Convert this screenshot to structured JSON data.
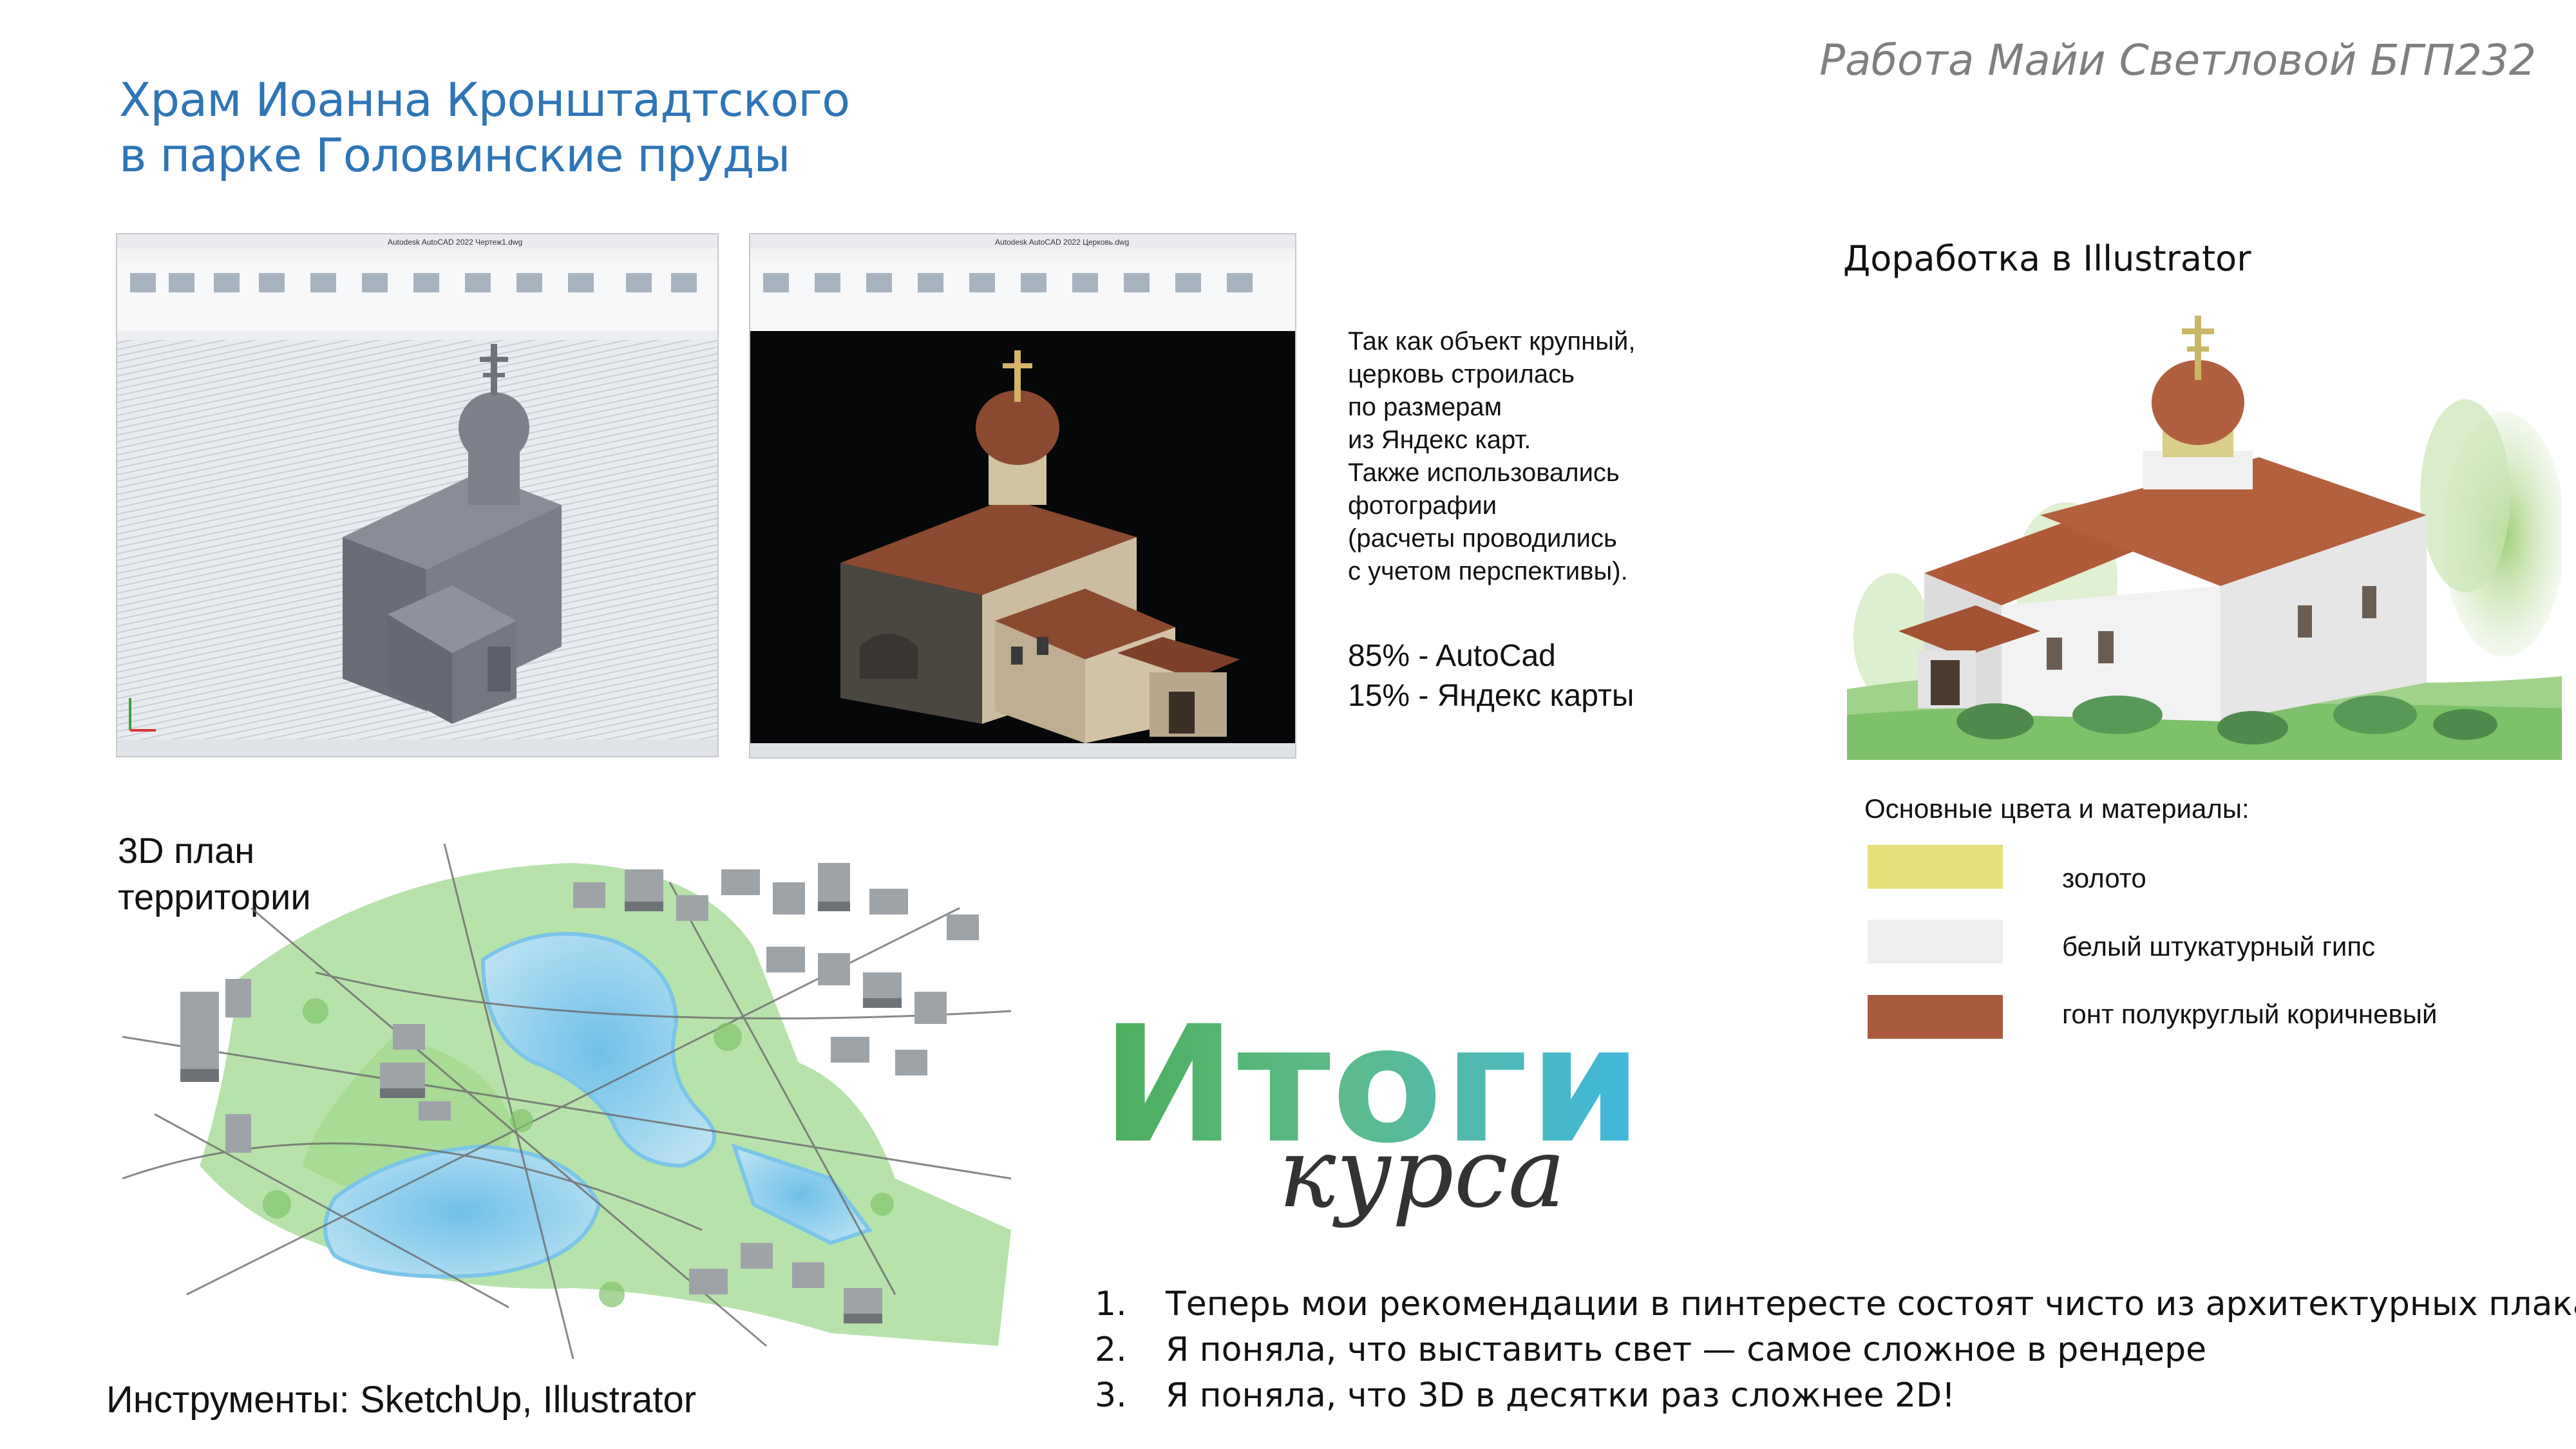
{
  "header": {
    "title_line1": "Храм Иоанна Кронштадтского",
    "title_line2": "в парке Головинские пруды",
    "author": "Работа Майи Светловой БГП232"
  },
  "cad_screenshots": {
    "left_window_title": "Autodesk AutoCAD 2022  Чертеж1.dwg",
    "right_window_title": "Autodesk AutoCAD 2022  Церковь.dwg"
  },
  "description": {
    "lines": [
      "Так как объект крупный,",
      "церковь строилась",
      "по размерам",
      "из Яндекс карт.",
      "Также использовались",
      "фотографии",
      "(расчеты проводились",
      "с учетом перспективы)."
    ],
    "stat1": "85% - AutoCad",
    "stat2": "15% - Яндекс карты"
  },
  "illustrator": {
    "caption": "Доработка в Illustrator"
  },
  "plan": {
    "caption_line1": "3D план",
    "caption_line2": "территории",
    "tools": "Инструменты: SketchUp, Illustrator"
  },
  "palette": {
    "title": "Основные цвета и материалы:",
    "items": [
      {
        "label": "золото",
        "color": "#e6e07a"
      },
      {
        "label": "белый штукатурный гипс",
        "color": "#efefef"
      },
      {
        "label": "гонт полукруглый коричневый",
        "color": "#a75a3c"
      }
    ]
  },
  "logo": {
    "main": "Итоги",
    "sub": "курса"
  },
  "findings": [
    {
      "num": "1.",
      "text": "Теперь мои рекомендации в пинтересте состоят чисто из архитектурных плакатов"
    },
    {
      "num": "2.",
      "text": "Я поняла, что выставить свет — самое сложное в рендере"
    },
    {
      "num": "3.",
      "text": "Я поняла, что 3D в десятки раз сложнее 2D!"
    }
  ]
}
